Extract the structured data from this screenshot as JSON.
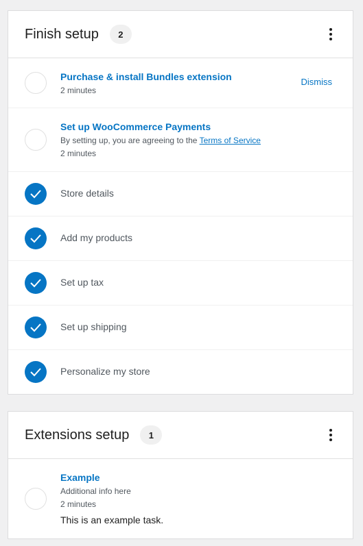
{
  "finish_setup": {
    "title": "Finish setup",
    "count": "2",
    "tasks": [
      {
        "title": "Purchase & install Bundles extension",
        "time": "2 minutes",
        "action": "Dismiss"
      },
      {
        "title": "Set up WooCommerce Payments",
        "description_prefix": "By setting up, you are agreeing to the",
        "description_link": "Terms of Service",
        "time": "2 minutes"
      }
    ],
    "completed": [
      {
        "title": "Store details"
      },
      {
        "title": "Add my products"
      },
      {
        "title": "Set up tax"
      },
      {
        "title": "Set up shipping"
      },
      {
        "title": "Personalize my store"
      }
    ]
  },
  "extensions_setup": {
    "title": "Extensions setup",
    "count": "1",
    "tasks": [
      {
        "title": "Example",
        "info": "Additional info here",
        "time": "2 minutes",
        "content": "This is an example task."
      }
    ]
  },
  "colors": {
    "accent": "#0675c4",
    "check_fill": "#0675c4",
    "page_bg": "#f0f0f1",
    "card_bg": "#ffffff"
  },
  "icons": {
    "menu": "vertical-ellipsis-icon",
    "checkmark": "checkmark-icon"
  }
}
